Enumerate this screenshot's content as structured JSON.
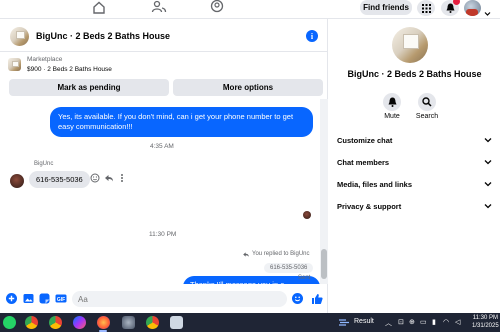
{
  "topnav": {
    "find_friends_label": "Find friends",
    "notification_badge": ""
  },
  "chat": {
    "title": "BigUnc · 2 Beds 2 Baths House",
    "marketplace_label": "Marketplace",
    "listing": "$900 · 2 Beds 2 Baths House",
    "mark_pending_label": "Mark as pending",
    "more_options_label": "More options",
    "messages": {
      "outgoing_1": "Yes, its available. If you don't mind, can i get your phone number to get easy communication!!!",
      "time_1": "4:35 AM",
      "sender_name": "BigUnc",
      "incoming_1": "616-535-5036",
      "time_2": "11:30 PM",
      "replied_to": "You replied to BigUnc",
      "quoted_reply": "616-535-5036",
      "outgoing_2": "Thanks I'll message you in a moment",
      "status": "Sent"
    },
    "composer": {
      "placeholder": "Aa"
    }
  },
  "right_panel": {
    "title": "BigUnc · 2 Beds 2 Baths House",
    "mute_label": "Mute",
    "search_label": "Search",
    "rows": [
      "Customize chat",
      "Chat members",
      "Media, files and links",
      "Privacy & support"
    ]
  },
  "taskbar": {
    "weather_label": "Result",
    "time": "11:30 PM",
    "date": "1/31/2025"
  },
  "colors": {
    "accent": "#0866ff",
    "bubble_in": "#e4e6eb",
    "taskbar": "#1f2535"
  },
  "icons": [
    "home-icon",
    "people-icon",
    "groups-icon",
    "grid-menu-icon",
    "bell-icon",
    "avatar",
    "info-icon",
    "plus-circle-icon",
    "photo-icon",
    "sticker-icon",
    "gif-icon",
    "emoji-icon",
    "thumbs-up-icon",
    "mute-bell-icon",
    "search-icon",
    "chevron-down-icon",
    "reply-icon",
    "more-icon"
  ]
}
